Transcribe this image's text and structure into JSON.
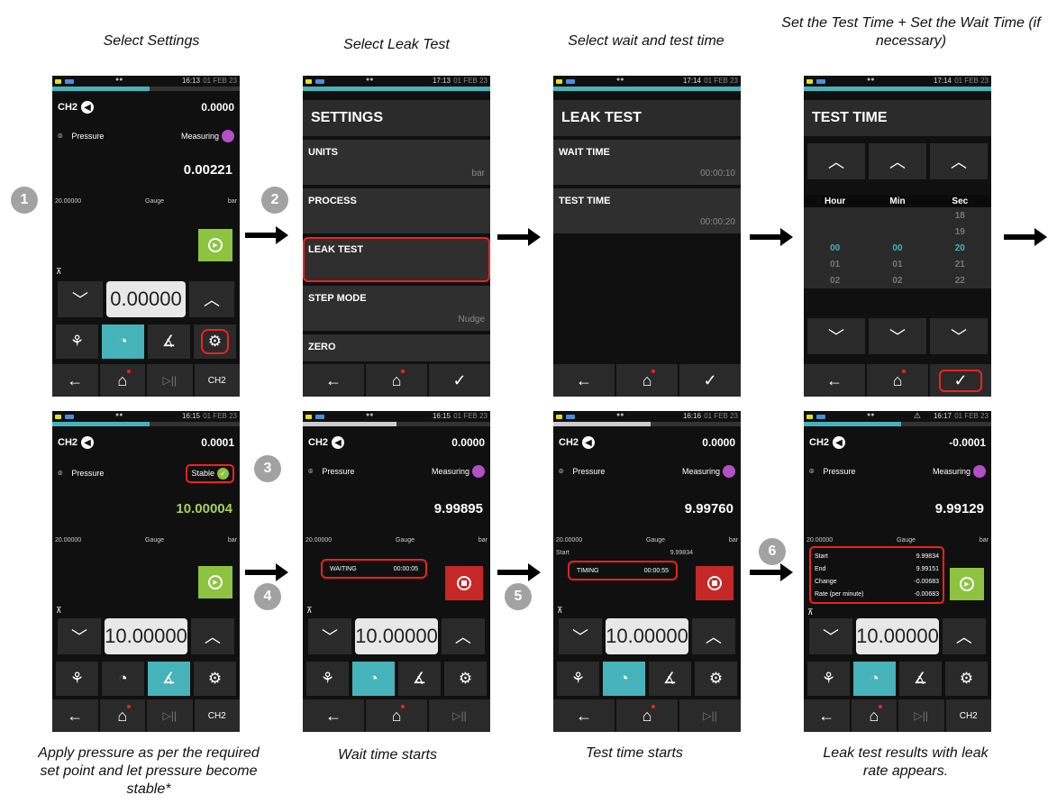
{
  "captions": {
    "top": [
      "Select Settings",
      "Select Leak Test",
      "Select wait and test time",
      "Set the Test Time + Set the Wait Time (if necessary)"
    ],
    "bottom": [
      "Apply pressure as per the required set point and let pressure become stable*",
      "Wait time starts",
      "Test time starts",
      "Leak test results with leak rate appears."
    ]
  },
  "steps": [
    "1",
    "2",
    "3",
    "4",
    "5",
    "6"
  ],
  "common": {
    "ch": "CH2",
    "sensor": "Pressure",
    "measuring": "Measuring",
    "stable": "Stable",
    "gauge": "Gauge",
    "unit": "bar",
    "range": "20.00000",
    "date": "01 FEB 23"
  },
  "screen1": {
    "time": "16:13",
    "top_value": "0.0000",
    "main_value": "0.00221",
    "setpoint": "0.00000"
  },
  "settings": {
    "time": "17:13",
    "title": "SETTINGS",
    "items": [
      {
        "label": "UNITS",
        "value": "bar"
      },
      {
        "label": "PROCESS",
        "value": ""
      },
      {
        "label": "LEAK TEST",
        "value": ""
      },
      {
        "label": "STEP MODE",
        "value": "Nudge"
      },
      {
        "label": "ZERO",
        "value": ""
      }
    ]
  },
  "leaktest": {
    "time": "17:14",
    "title": "LEAK TEST",
    "items": [
      {
        "label": "WAIT TIME",
        "value": "00:00:10"
      },
      {
        "label": "TEST TIME",
        "value": "00:00:20"
      }
    ]
  },
  "testtime": {
    "time": "17:14",
    "title": "TEST TIME",
    "cols": [
      "Hour",
      "Min",
      "Sec"
    ],
    "rows": [
      [
        "",
        "",
        "18"
      ],
      [
        "",
        "",
        "19"
      ],
      [
        "00",
        "00",
        "20"
      ],
      [
        "01",
        "01",
        "21"
      ],
      [
        "02",
        "02",
        "22"
      ]
    ]
  },
  "screen5": {
    "time": "16:15",
    "top_value": "0.0001",
    "main_value": "10.00004",
    "setpoint": "10.00000"
  },
  "screen6": {
    "time": "16:15",
    "top_value": "0.0000",
    "main_value": "9.99895",
    "setpoint": "10.00000",
    "status": "WAITING",
    "timer": "00:00:05"
  },
  "screen7": {
    "time": "16:16",
    "top_value": "0.0000",
    "main_value": "9.99760",
    "setpoint": "10.00000",
    "start_label": "Start",
    "start_value": "9.99834",
    "status": "TIMING",
    "timer": "00:00:55"
  },
  "screen8": {
    "time": "16:17",
    "top_value": "-0.0001",
    "main_value": "9.99129",
    "setpoint": "10.00000",
    "results": [
      {
        "label": "Start",
        "value": "9.99834"
      },
      {
        "label": "End",
        "value": "9.99151"
      },
      {
        "label": "Change",
        "value": "-0.00683"
      },
      {
        "label": "Rate (per minute)",
        "value": "-0.00683"
      }
    ]
  },
  "icons": {
    "back": "←",
    "home": "⌂",
    "check": "✓",
    "play_pause": "▷||",
    "up": "︿",
    "down": "﹀",
    "gear": "⚙"
  }
}
